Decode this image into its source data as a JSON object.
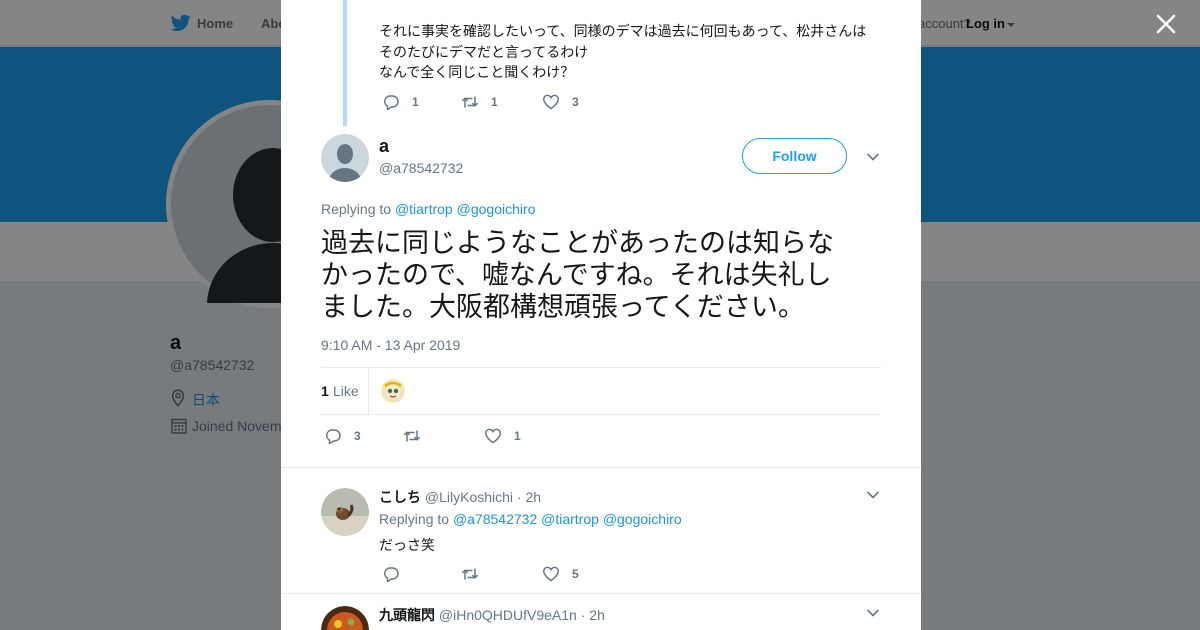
{
  "nav": {
    "home_label": "Home",
    "about_label": "Abo",
    "account_text": "account?",
    "login_label": "Log in",
    "brand_color": "#1da1f2"
  },
  "profile": {
    "name": "a",
    "handle": "@a78542732",
    "location": "日本",
    "joined": "Joined Novem",
    "icons": [
      "location-icon",
      "calendar-icon"
    ]
  },
  "modal": {
    "close_icon": "close-icon",
    "parent_tweet": {
      "lines": [
        "それに事実を確認したいって、同様のデマは過去に何回もあって、松井さんは",
        "そのたびにデマだと言ってるわけ",
        "なんで全く同じこと聞くわけ？"
      ],
      "replies": "1",
      "retweets": "1",
      "likes": "3"
    },
    "main_tweet": {
      "name": "a",
      "handle": "@a78542732",
      "follow_label": "Follow",
      "replying_label": "Replying to",
      "replying_to": [
        "@tiartrop",
        "@gogoichiro"
      ],
      "lines": [
        "過去に同じようなことがあったのは知らな",
        "かったので、嘘なんですね。それは失礼し",
        "ました。大阪都構想頑張ってください。"
      ],
      "timestamp": "9:10 AM - 13 Apr 2019",
      "like_count": "1",
      "like_label": "Like",
      "replies": "3",
      "retweets": "",
      "likes": "1"
    },
    "replies": [
      {
        "name": "こしち",
        "handle": "@LilyKoshichi",
        "dot": "·",
        "time": "2h",
        "replying_label": "Replying to",
        "replying_to": [
          "@a78542732",
          "@tiartrop",
          "@gogoichiro"
        ],
        "text": "だっさ笑",
        "replies": "",
        "retweets": "",
        "likes": "5"
      },
      {
        "name": "九頭龍閃",
        "handle": "@iHn0QHDUfV9eA1n",
        "dot": "·",
        "time": "2h"
      }
    ]
  },
  "colors": {
    "accent": "#1da1f2",
    "link": "#1b95e0",
    "muted": "#657786",
    "thread_line": "#b1dcf9",
    "page_bg": "#e6ecf0"
  }
}
